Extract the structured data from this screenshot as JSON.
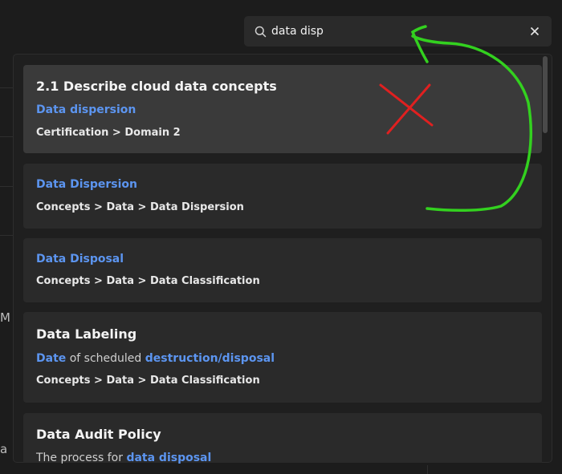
{
  "search": {
    "value": "data disp",
    "icon": "search-icon",
    "clear_icon": "close-icon"
  },
  "background": {
    "letter_m": "M",
    "letter_a": "a"
  },
  "results": [
    {
      "title": "2.1 Describe cloud data concepts",
      "link": "Data dispersion",
      "path": "Certification > Domain 2"
    },
    {
      "link": "Data Dispersion",
      "path": "Concepts > Data > Data Dispersion"
    },
    {
      "link": "Data Disposal",
      "path": "Concepts > Data > Data Classification"
    },
    {
      "title": "Data Labeling",
      "desc": {
        "p1": "Date",
        "p2": " of scheduled ",
        "p3": "destruction/disposal"
      },
      "path": "Concepts > Data > Data Classification"
    },
    {
      "title": "Data Audit Policy",
      "desc": {
        "p1": "The process for ",
        "p2": "data disposal"
      }
    }
  ],
  "colors": {
    "link": "#5c95f0",
    "annotation_x": "#e02020",
    "annotation_arrow": "#33d11f"
  }
}
